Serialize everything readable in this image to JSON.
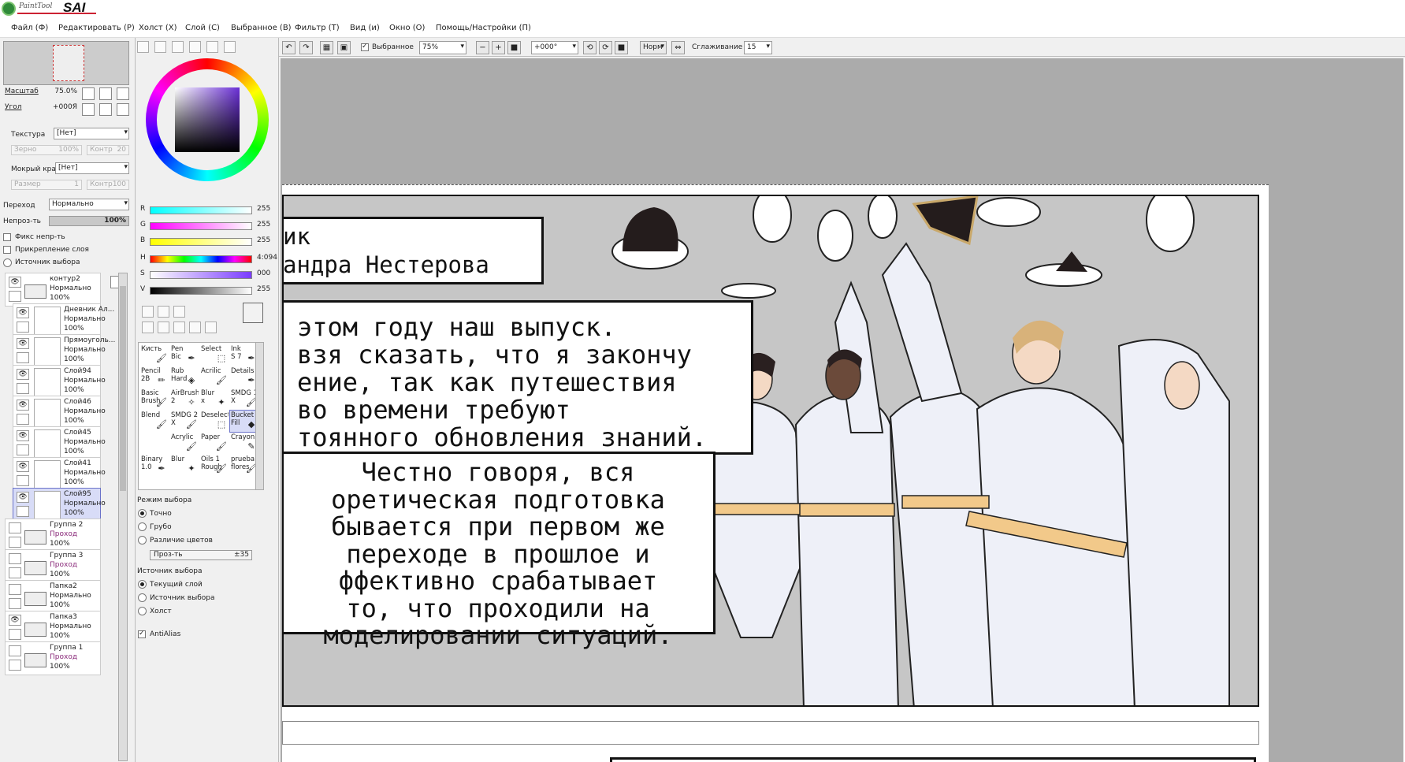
{
  "app": {
    "logo_small": "PaintTool",
    "logo_big": "SAI"
  },
  "menu": [
    "Файл (Ф)",
    "Редактировать (Р)",
    "Холст (Х)",
    "Слой (С)",
    "Выбранное (В)",
    "Фильтр (Т)",
    "Вид (и)",
    "Окно (О)",
    "Помощь/Настройки (П)"
  ],
  "navigator": {
    "zoom_label": "Масштаб",
    "zoom_value": "75.0%",
    "angle_label": "Угол",
    "angle_value": "+000Я"
  },
  "brush": {
    "texture_label": "Текстура",
    "texture_value": "[Нет]",
    "grain_label": "Зерно",
    "grain_value": "100%",
    "contrast_label": "Контр",
    "contrast_value": "20",
    "wet_edge_label": "Мокрый край",
    "wet_edge_value": "[Нет]",
    "size_label": "Размер",
    "size_value": "1",
    "size_contrast_label": "Контр",
    "size_contrast_value": "100"
  },
  "layer_props": {
    "blend_label": "Переход",
    "blend_value": "Нормально",
    "opacity_label": "Непроз-ть",
    "opacity_value": "100%",
    "opacity_level": 1.0,
    "chk_opacity": "Фикс непр-ть",
    "chk_clip": "Прикрепление слоя",
    "chk_source": "Источник выбора"
  },
  "layers": [
    {
      "name": "контур2",
      "mode": "Нормально",
      "opacity": "100%",
      "folder": true,
      "visible": true,
      "indent": false
    },
    {
      "name": "Дневник Ал...",
      "mode": "Нормально",
      "opacity": "100%",
      "folder": false,
      "visible": true,
      "indent": true
    },
    {
      "name": "Прямоуголь...",
      "mode": "Нормально",
      "opacity": "100%",
      "folder": false,
      "visible": true,
      "indent": true
    },
    {
      "name": "Слой94",
      "mode": "Нормально",
      "opacity": "100%",
      "folder": false,
      "visible": true,
      "indent": true
    },
    {
      "name": "Слой46",
      "mode": "Нормально",
      "opacity": "100%",
      "folder": false,
      "visible": true,
      "indent": true
    },
    {
      "name": "Слой45",
      "mode": "Нормально",
      "opacity": "100%",
      "folder": false,
      "visible": true,
      "indent": true
    },
    {
      "name": "Слой41",
      "mode": "Нормально",
      "opacity": "100%",
      "folder": false,
      "visible": true,
      "indent": true
    },
    {
      "name": "Слой95",
      "mode": "Нормально",
      "opacity": "100%",
      "folder": false,
      "visible": true,
      "indent": true,
      "selected": true
    },
    {
      "name": "Группа 2",
      "mode": "Проход",
      "opacity": "100%",
      "folder": true,
      "visible": false,
      "indent": false
    },
    {
      "name": "Группа 3",
      "mode": "Проход",
      "opacity": "100%",
      "folder": true,
      "visible": false,
      "indent": false
    },
    {
      "name": "Папка2",
      "mode": "Нормально",
      "opacity": "100%",
      "folder": true,
      "visible": false,
      "indent": false
    },
    {
      "name": "Папка3",
      "mode": "Нормально",
      "opacity": "100%",
      "folder": true,
      "visible": true,
      "indent": false
    },
    {
      "name": "Группа 1",
      "mode": "Проход",
      "opacity": "100%",
      "folder": true,
      "visible": false,
      "indent": false
    }
  ],
  "color": {
    "primary": "#f2f2f2",
    "secondary": "#9e2a22",
    "sliders": [
      {
        "label": "R",
        "value": "255"
      },
      {
        "label": "G",
        "value": "255"
      },
      {
        "label": "B",
        "value": "255"
      },
      {
        "label": "H",
        "value": "4:094"
      },
      {
        "label": "S",
        "value": "000"
      },
      {
        "label": "V",
        "value": "255"
      }
    ]
  },
  "tools": [
    {
      "label": "Кисть",
      "icon": "brush-icon"
    },
    {
      "label": "Pen\nBic",
      "icon": "pen-icon"
    },
    {
      "label": "Select",
      "icon": "select-icon"
    },
    {
      "label": "Ink\nS 7",
      "icon": "pen-icon"
    },
    {
      "label": "Pencil\n2B",
      "icon": "pencil-icon"
    },
    {
      "label": "Rub\nHard",
      "icon": "eraser-icon"
    },
    {
      "label": "Acrilic",
      "icon": "brush-icon"
    },
    {
      "label": "Details",
      "icon": "pen-icon"
    },
    {
      "label": "Basic\nBrush",
      "icon": "brush-icon"
    },
    {
      "label": "AirBrush\n2",
      "icon": "airbrush-icon"
    },
    {
      "label": "Blur\nx",
      "icon": "blur-icon"
    },
    {
      "label": "SMDG 1\nX",
      "icon": "brush-icon"
    },
    {
      "label": "Blend",
      "icon": "brush-icon"
    },
    {
      "label": "SMDG 2\nX",
      "icon": "brush-icon"
    },
    {
      "label": "Deselect",
      "icon": "deselect-icon"
    },
    {
      "label": "Bucket\nFill",
      "icon": "bucket-icon",
      "selected": true
    },
    {
      "label": "",
      "icon": ""
    },
    {
      "label": "Acrylic",
      "icon": "brush-icon"
    },
    {
      "label": "Paper",
      "icon": "brush-icon"
    },
    {
      "label": "Crayon",
      "icon": "crayon-icon"
    },
    {
      "label": "Binary\n1.0",
      "icon": "pen-icon"
    },
    {
      "label": "Blur",
      "icon": "blur-icon"
    },
    {
      "label": "Oils 1\nRough",
      "icon": "brush-icon"
    },
    {
      "label": "prueba\nflores",
      "icon": "brush-icon"
    }
  ],
  "selection": {
    "mode_title": "Режим выбора",
    "mode_options": [
      "Точно",
      "Грубо",
      "Различие цветов"
    ],
    "mode_selected": 0,
    "transp_label": "Проз-ть",
    "transp_value": "±35",
    "source_title": "Источник выбора",
    "source_options": [
      "Текущий слой",
      "Источник выбора",
      "Холст"
    ],
    "source_selected": 0,
    "antialias": "AntiAlias"
  },
  "toolbar": {
    "selected_label": "Выбранное",
    "zoom": "75%",
    "angle": "+000°",
    "norm": "Норм",
    "smoothing_label": "Сглаживание",
    "smoothing_value": "15"
  },
  "comic": {
    "bubble1": [
      "ик",
      "андра Нестерова"
    ],
    "bubble2": [
      "этом году наш выпуск.",
      "взя сказать, что я закончу",
      "ение, так как путешествия",
      " во времени требуют",
      "тоянного обновления знаний."
    ],
    "bubble3": [
      "Честно говоря, вся",
      "оретическая подготовка",
      "бывается при первом же",
      "переходе в прошлое и",
      "ффективно срабатывает",
      "то, что проходили на",
      "моделировании ситуаций."
    ]
  }
}
